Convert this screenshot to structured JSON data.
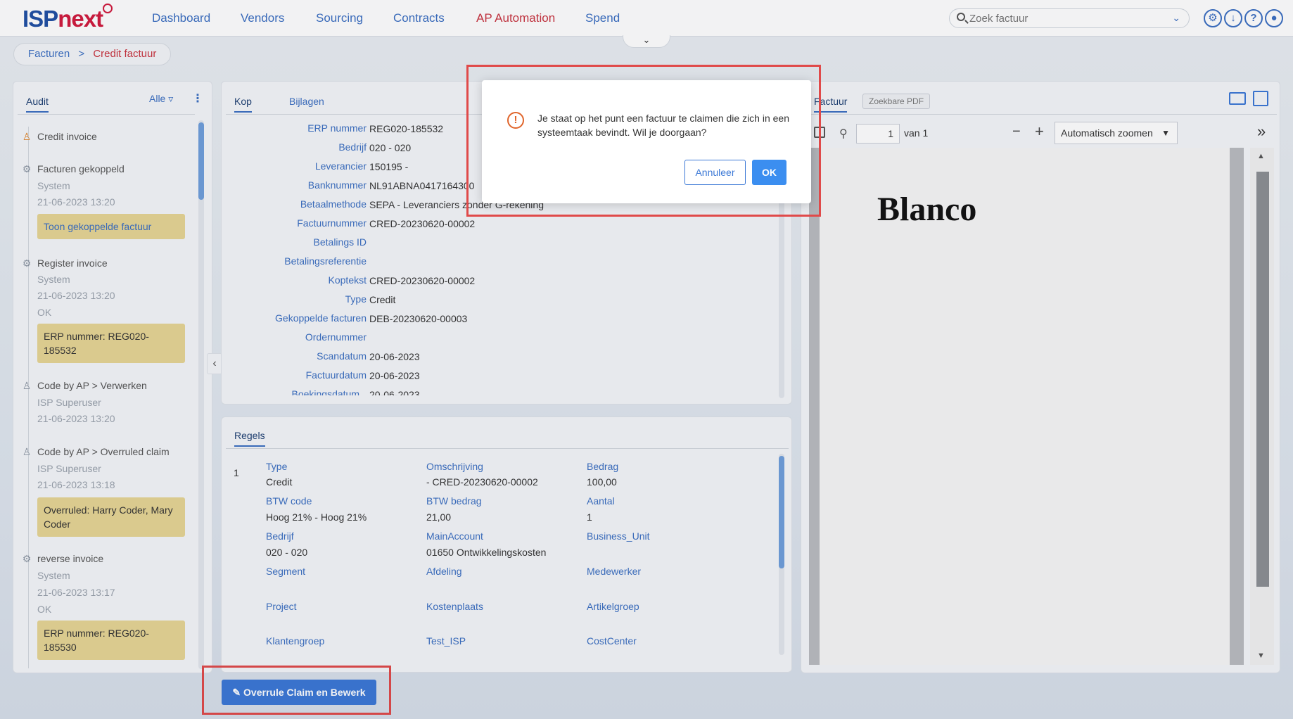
{
  "app": {
    "logo_isp": "ISP",
    "logo_next": "next"
  },
  "nav": {
    "items": [
      {
        "label": "Dashboard"
      },
      {
        "label": "Vendors"
      },
      {
        "label": "Sourcing"
      },
      {
        "label": "Contracts"
      },
      {
        "label": "AP Automation"
      },
      {
        "label": "Spend"
      }
    ],
    "active": "AP Automation",
    "search_placeholder": "Zoek factuur",
    "icons": [
      "gear-icon",
      "download-icon",
      "help-icon",
      "user-icon"
    ]
  },
  "breadcrumb": {
    "parent": "Facturen",
    "separator": ">",
    "current": "Credit factuur"
  },
  "audit": {
    "tab": "Audit",
    "filter_label": "Alle",
    "items": [
      {
        "title": "Credit invoice",
        "icon": "user-icon"
      },
      {
        "title": "Facturen gekoppeld",
        "user": "System",
        "date": "21-06-2023 13:20",
        "note": "Toon gekoppelde factuur",
        "icon": "gear-icon"
      },
      {
        "title": "Register invoice",
        "user": "System",
        "date": "21-06-2023 13:20",
        "status": "OK",
        "note": "ERP nummer: REG020-185532",
        "icon": "gear-icon"
      },
      {
        "title": "Code by AP > Verwerken",
        "user": "ISP Superuser",
        "date": "21-06-2023 13:20",
        "icon": "user-icon"
      },
      {
        "title": "Code by AP > Overruled claim",
        "user": "ISP Superuser",
        "date": "21-06-2023 13:18",
        "note": "Overruled: Harry Coder, Mary Coder",
        "icon": "user-icon"
      },
      {
        "title": "reverse invoice",
        "user": "System",
        "date": "21-06-2023 13:17",
        "status": "OK",
        "note": "ERP nummer: REG020-185530",
        "icon": "gear-icon"
      }
    ]
  },
  "kop": {
    "tabs": [
      "Kop",
      "Bijlagen"
    ],
    "fields": [
      {
        "label": "ERP nummer",
        "value": "REG020-185532"
      },
      {
        "label": "Bedrijf",
        "value": "020 - 020"
      },
      {
        "label": "Leverancier",
        "value": "150195 -"
      },
      {
        "label": "Banknummer",
        "value": "NL91ABNA0417164300"
      },
      {
        "label": "Betaalmethode",
        "value": "SEPA - Leveranciers zonder G-rekening"
      },
      {
        "label": "Factuurnummer",
        "value": "CRED-20230620-00002"
      },
      {
        "label": "Betalings ID",
        "value": ""
      },
      {
        "label": "Betalingsreferentie",
        "value": ""
      },
      {
        "label": "Koptekst",
        "value": "CRED-20230620-00002"
      },
      {
        "label": "Type",
        "value": "Credit"
      },
      {
        "label": "Gekoppelde facturen",
        "value": "DEB-20230620-00003"
      },
      {
        "label": "Ordernummer",
        "value": ""
      },
      {
        "label": "Scandatum",
        "value": "20-06-2023"
      },
      {
        "label": "Factuurdatum",
        "value": "20-06-2023"
      },
      {
        "label": "Boekingsdatum",
        "value": "20-06-2023"
      }
    ]
  },
  "regels": {
    "tab": "Regels",
    "line_number": "1",
    "cells": {
      "type_label": "Type",
      "type_value": "Credit",
      "omschrijving_label": "Omschrijving",
      "omschrijving_value": "- CRED-20230620-00002",
      "bedrag_label": "Bedrag",
      "bedrag_value": "100,00",
      "btwcode_label": "BTW code",
      "btwcode_value": "Hoog 21% - Hoog 21%",
      "btwbedrag_label": "BTW bedrag",
      "btwbedrag_value": "21,00",
      "aantal_label": "Aantal",
      "aantal_value": "1",
      "bedrijf_label": "Bedrijf",
      "bedrijf_value": "020 - 020",
      "mainaccount_label": "MainAccount",
      "mainaccount_value": "01650 Ontwikkelingskosten",
      "businessunit_label": "Business_Unit",
      "segment_label": "Segment",
      "afdeling_label": "Afdeling",
      "medewerker_label": "Medewerker",
      "project_label": "Project",
      "kostenplaats_label": "Kostenplaats",
      "artikelgroep_label": "Artikelgroep",
      "klantengroep_label": "Klantengroep",
      "testisp_label": "Test_ISP",
      "costcenter_label": "CostCenter"
    }
  },
  "factuur": {
    "tab_active": "Factuur",
    "tab_other": "Zoekbare PDF",
    "page_input": "1",
    "page_of": "van 1",
    "zoom": "Automatisch zoomen",
    "pdf_text": "Blanco"
  },
  "actions": {
    "overrule_button": "Overrule Claim en Bewerk"
  },
  "modal": {
    "message": "Je staat op het punt een factuur te claimen die zich in een systeemtaak bevindt. Wil je doorgaan?",
    "cancel_label": "Annuleer",
    "ok_label": "OK"
  },
  "colors": {
    "brand_blue": "#1f4fa3",
    "brand_red": "#d11a3d",
    "accent_blue": "#3b78d6",
    "note_yellow": "#e6d594",
    "highlight_red": "#e04a4a"
  }
}
